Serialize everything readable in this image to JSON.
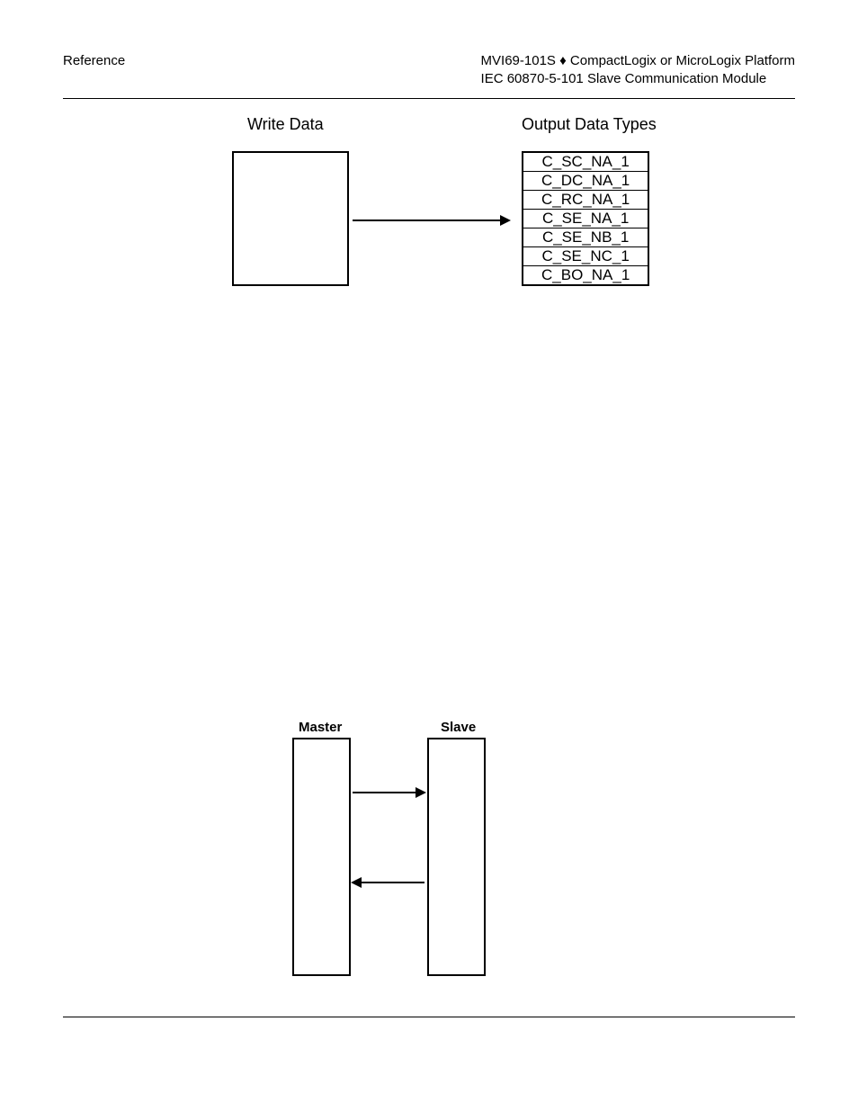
{
  "header": {
    "left": "Reference",
    "right_line1": "MVI69-101S ♦ CompactLogix or MicroLogix Platform",
    "right_line2": "IEC 60870-5-101 Slave Communication Module"
  },
  "diagram_top": {
    "left_label": "Write Data",
    "right_label": "Output Data Types",
    "rows": [
      "C_SC_NA_1",
      "C_DC_NA_1",
      "C_RC_NA_1",
      "C_SE_NA_1",
      "C_SE_NB_1",
      "C_SE_NC_1",
      "C_BO_NA_1"
    ]
  },
  "diagram_bottom": {
    "master_label": "Master",
    "slave_label": "Slave"
  }
}
